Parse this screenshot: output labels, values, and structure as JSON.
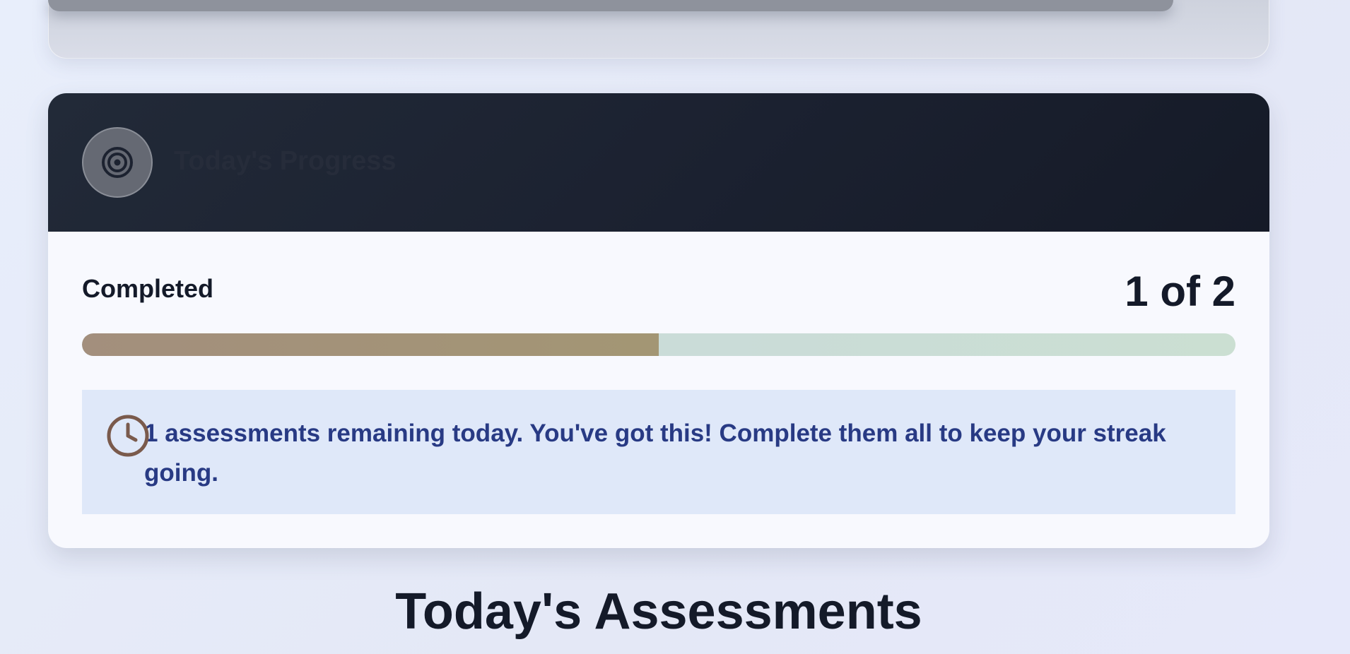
{
  "progress_card": {
    "title": "Today's Progress",
    "icon": "target-icon",
    "completed_label": "Completed",
    "completed_value": "1 of 2",
    "progress_fraction": 0.5,
    "notice": {
      "icon": "clock-icon",
      "text": "1 assessments remaining today. You've got this! Complete them all to keep your streak going."
    }
  },
  "section": {
    "title": "Today's Assessments"
  },
  "colors": {
    "header_bg": "#1b2130",
    "notice_bg": "#dfe8f9",
    "notice_text": "#283a84",
    "progress_fill": "#a39674",
    "progress_track": "#c9d8df",
    "clock_icon": "#7a5a4c"
  }
}
